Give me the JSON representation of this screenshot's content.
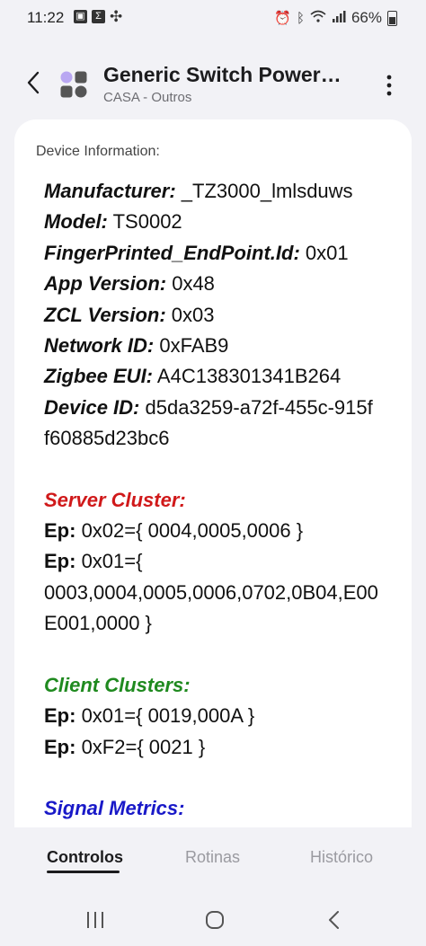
{
  "status_bar": {
    "time": "11:22",
    "battery": "66%",
    "icons_left": [
      "gallery-icon",
      "sigma-icon",
      "fan-icon"
    ],
    "icons_right": [
      "alarm-icon",
      "bluetooth-icon",
      "wifi-icon",
      "signal-icon",
      "battery-icon"
    ]
  },
  "header": {
    "title": "Generic Switch Power…",
    "subtitle": "CASA - Outros"
  },
  "card": {
    "label": "Device Information:",
    "fields": [
      {
        "key": "Manufacturer:",
        "value": " _TZ3000_lmlsduws"
      },
      {
        "key": "Model:",
        "value": " TS0002"
      },
      {
        "key": "FingerPrinted_EndPoint.Id:",
        "value": " 0x01"
      },
      {
        "key": "App Version:",
        "value": " 0x48"
      },
      {
        "key": "ZCL Version:",
        "value": " 0x03"
      },
      {
        "key": "Network ID:",
        "value": " 0xFAB9"
      },
      {
        "key": "Zigbee EUI:",
        "value": " A4C138301341B264"
      },
      {
        "key": "Device ID:",
        "value": " d5da3259-a72f-455c-915f",
        "continuation": "f60885d23bc6"
      }
    ],
    "server_cluster": {
      "title": "Server Cluster:",
      "ep_label": "Ep:",
      "line1": " 0x02={ 0004,0005,0006 }",
      "line2": " 0x01={",
      "line3": "0003,0004,0005,0006,0702,0B04,E00",
      "line4": "E001,0000 }"
    },
    "client_clusters": {
      "title": "Client Clusters:",
      "ep_label": "Ep:",
      "line1": " 0x01={ 0019,000A }",
      "line2": " 0xF2={ 0021 }"
    },
    "signal_metrics": {
      "title": "Signal Metrics:"
    }
  },
  "tabs": [
    {
      "label": "Controlos",
      "active": true
    },
    {
      "label": "Rotinas",
      "active": false
    },
    {
      "label": "Histórico",
      "active": false
    }
  ],
  "colors": {
    "server_title": "#d0191a",
    "client_title": "#1f8a1f",
    "signal_title": "#1919c8",
    "logo_purple": "#b9a7f2",
    "logo_dark": "#555555"
  }
}
